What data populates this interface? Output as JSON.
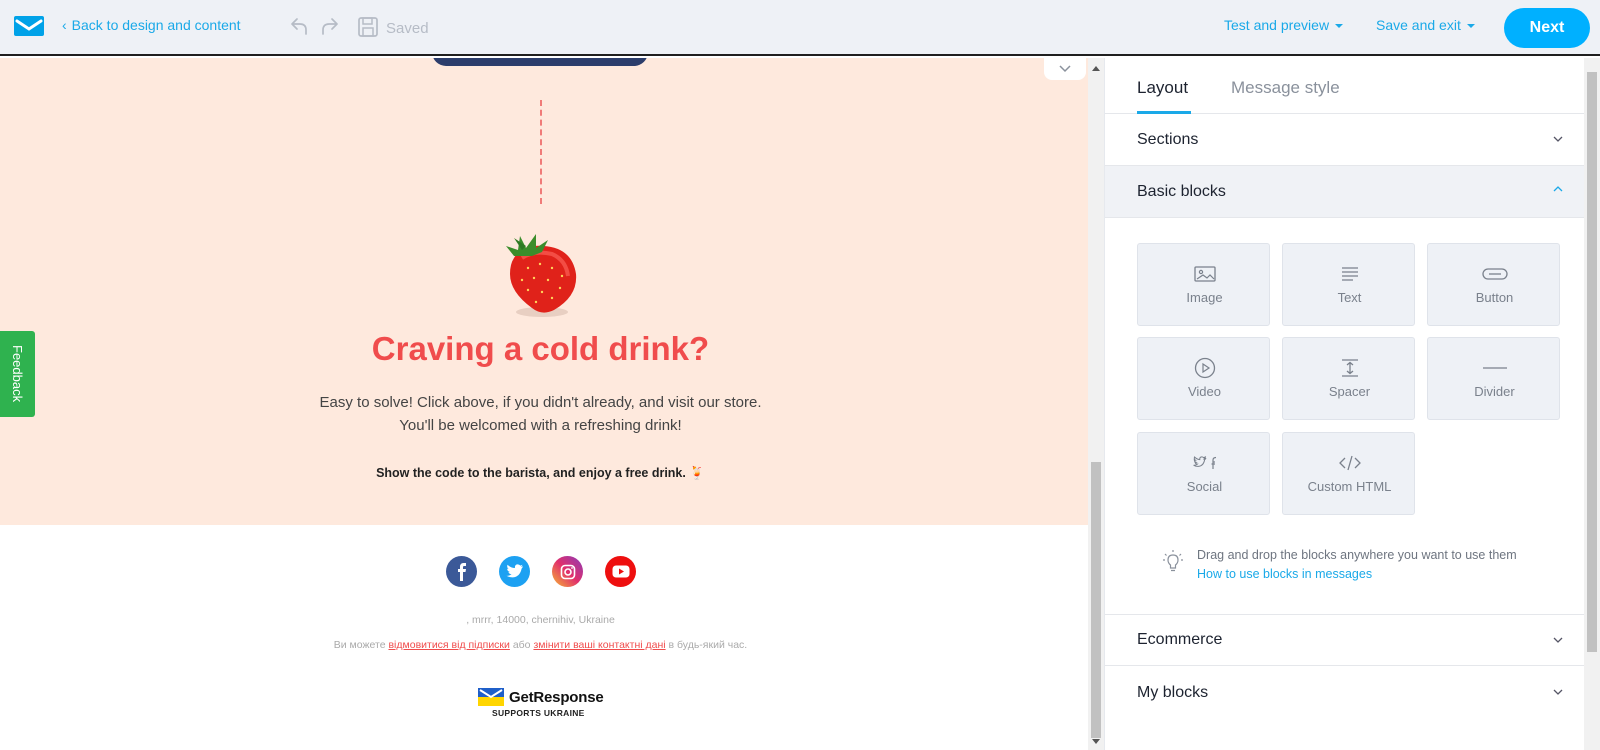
{
  "topbar": {
    "back_label": "Back to design and content",
    "saved_label": "Saved",
    "test_preview_label": "Test and preview",
    "save_exit_label": "Save and exit",
    "next_label": "Next",
    "accent_color": "#1aa9e8",
    "next_color": "#00b0ff"
  },
  "email": {
    "headline": "Craving a cold drink?",
    "body_line1": "Easy to solve! Click above, if you didn't already, and visit our store.",
    "body_line2": "You'll be welcomed with a refreshing drink!",
    "code_line": "Show the code to the barista, and enjoy a free drink. 🍹",
    "social_icons": [
      "facebook-icon",
      "twitter-icon",
      "instagram-icon",
      "youtube-icon"
    ],
    "address": ", mrrr, 14000, chernihiv, Ukraine",
    "unsub_prefix": "Ви можете",
    "unsub_link": "відмовитися від підписки",
    "unsub_middle": "або",
    "change_link": "змінити ваші контактні дані",
    "unsub_suffix": "в будь-який час.",
    "brand_name": "GetResponse",
    "brand_sub": "SUPPORTS UKRAINE",
    "peach_color": "#fee9dd",
    "headline_color": "#f04c4c"
  },
  "feedback_label": "Feedback",
  "panel": {
    "tabs": [
      {
        "label": "Layout",
        "active": true
      },
      {
        "label": "Message style",
        "active": false
      }
    ],
    "sections_label": "Sections",
    "basic_blocks_label": "Basic blocks",
    "blocks": [
      {
        "label": "Image",
        "icon": "image-icon"
      },
      {
        "label": "Text",
        "icon": "text-icon"
      },
      {
        "label": "Button",
        "icon": "button-icon"
      },
      {
        "label": "Video",
        "icon": "video-icon"
      },
      {
        "label": "Spacer",
        "icon": "spacer-icon"
      },
      {
        "label": "Divider",
        "icon": "divider-icon"
      },
      {
        "label": "Social",
        "icon": "social-icon"
      },
      {
        "label": "Custom HTML",
        "icon": "code-icon"
      }
    ],
    "tip_text": "Drag and drop the blocks anywhere you want to use them",
    "tip_link": "How to use blocks in messages",
    "ecommerce_label": "Ecommerce",
    "my_blocks_label": "My blocks"
  }
}
